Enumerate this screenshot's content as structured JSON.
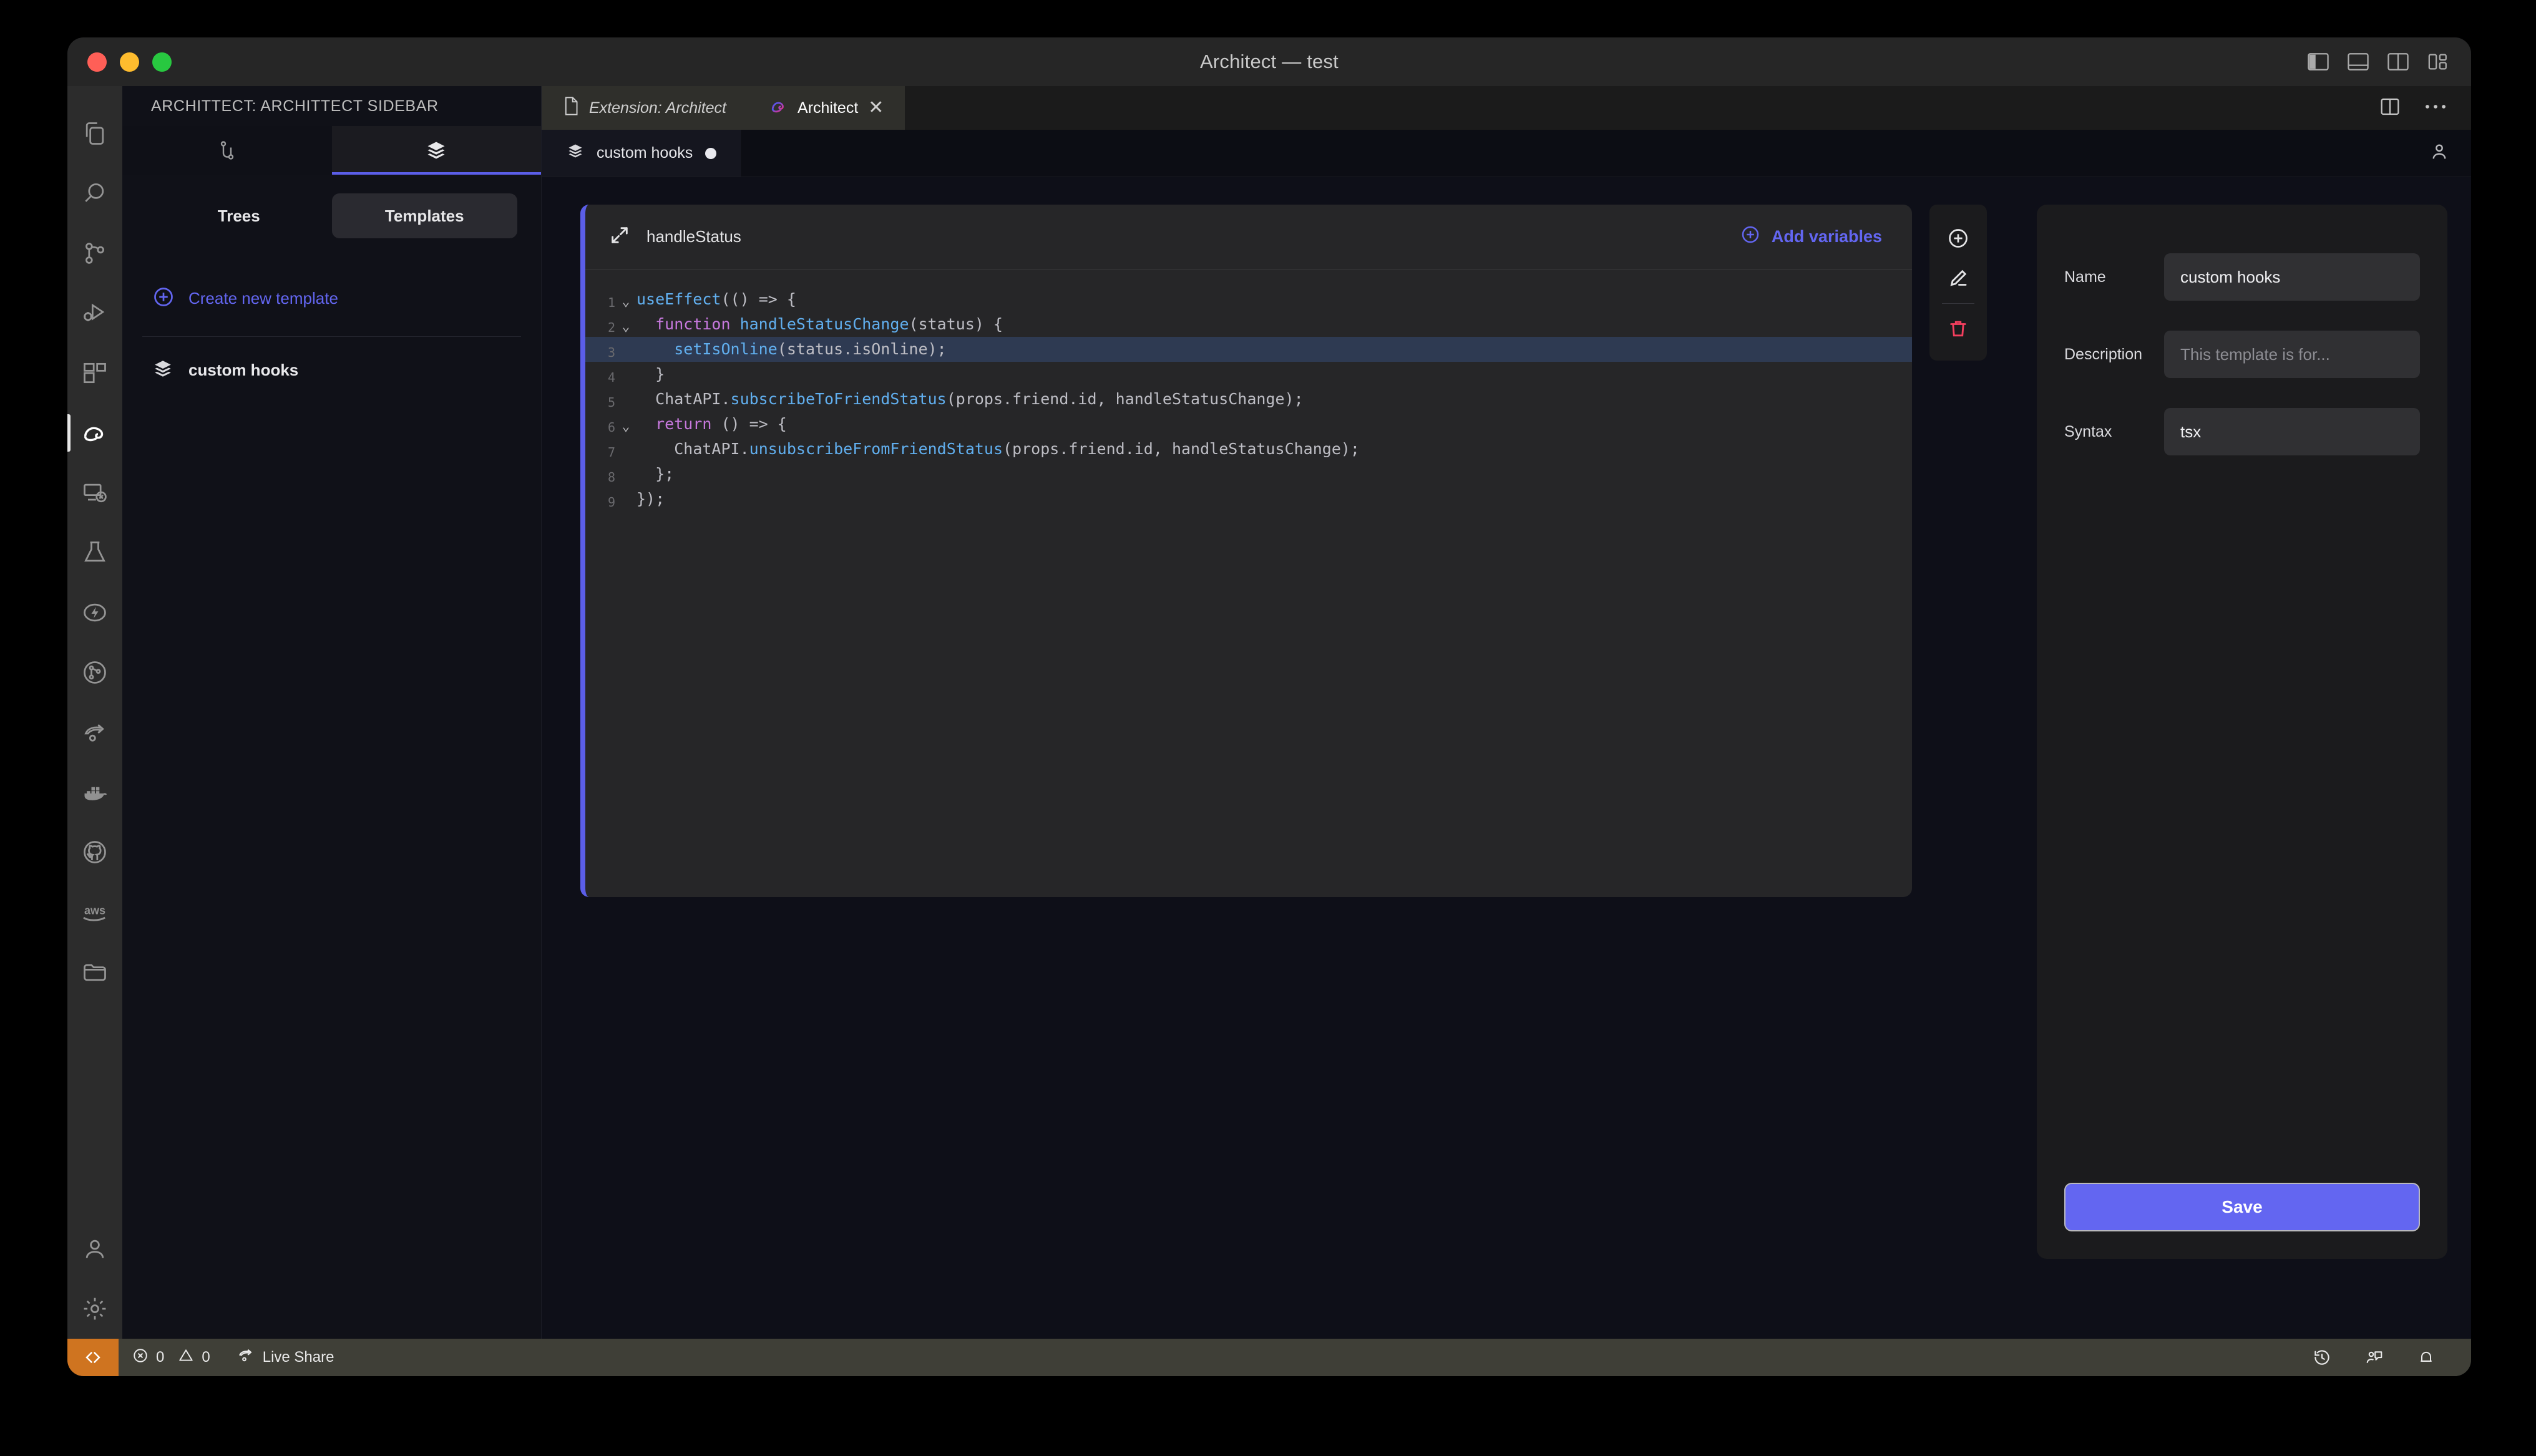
{
  "window": {
    "title": "Architect — test",
    "traffic_lights": [
      "close",
      "minimize",
      "maximize"
    ],
    "layout_icons": [
      "toggle-primary-sidebar-icon",
      "toggle-panel-icon",
      "toggle-secondary-sidebar-icon",
      "customize-layout-icon"
    ]
  },
  "activity_bar": {
    "items": [
      {
        "name": "explorer-icon",
        "active": false
      },
      {
        "name": "search-icon",
        "active": false
      },
      {
        "name": "source-control-icon",
        "active": false
      },
      {
        "name": "run-and-debug-icon",
        "active": false
      },
      {
        "name": "extensions-icon",
        "active": false
      },
      {
        "name": "architect-icon",
        "active": true
      },
      {
        "name": "remote-explorer-icon",
        "active": false
      },
      {
        "name": "testing-flask-icon",
        "active": false
      },
      {
        "name": "thunder-client-icon",
        "active": false
      },
      {
        "name": "gitlens-icon",
        "active": false
      },
      {
        "name": "share-icon",
        "active": false
      },
      {
        "name": "docker-icon",
        "active": false
      },
      {
        "name": "github-icon",
        "active": false
      },
      {
        "name": "aws-icon",
        "active": false
      },
      {
        "name": "folder-icon",
        "active": false
      }
    ],
    "bottom": [
      {
        "name": "account-icon"
      },
      {
        "name": "settings-gear-icon"
      }
    ]
  },
  "sidebar": {
    "title": "ARCHITTECT: ARCHITTECT SIDEBAR",
    "view_tabs": [
      {
        "name": "trees-view-icon",
        "active": false
      },
      {
        "name": "templates-view-icon",
        "active": true
      }
    ],
    "segmented": {
      "options": [
        "Trees",
        "Templates"
      ],
      "selected": "Templates"
    },
    "create_new_template": "Create new template",
    "templates": [
      {
        "label": "custom hooks"
      }
    ]
  },
  "editor": {
    "tabs": [
      {
        "label": "Extension: Architect",
        "icon": "file-icon",
        "active": false,
        "italic": true,
        "closable": false
      },
      {
        "label": "Architect",
        "icon": "architect-logo-icon",
        "active": true,
        "italic": false,
        "closable": true
      }
    ],
    "tabbar_actions": [
      "split-editor-icon",
      "more-actions-icon"
    ],
    "inner_tabs": [
      {
        "label": "custom hooks",
        "icon": "layers-icon",
        "dirty": true,
        "active": true
      }
    ],
    "inner_tabbar_actions": [
      "account-icon"
    ]
  },
  "code_card": {
    "expand_icon": "expand-diagonal-icon",
    "title": "handleStatus",
    "add_variables_label": "Add variables",
    "accent_color": "#5b5ee8",
    "highlighted_line": 3,
    "lines": [
      {
        "n": 1,
        "fold": true,
        "indent": 0,
        "tokens": [
          {
            "t": "useEffect",
            "c": "k-fn"
          },
          {
            "t": "((",
            "c": "k-plain"
          },
          {
            "t": ") ",
            "c": "k-plain"
          },
          {
            "t": "=>",
            "c": "k-plain"
          },
          {
            "t": " {",
            "c": "k-plain"
          }
        ]
      },
      {
        "n": 2,
        "fold": true,
        "indent": 1,
        "tokens": [
          {
            "t": "function ",
            "c": "k-kw"
          },
          {
            "t": "handleStatusChange",
            "c": "k-fn"
          },
          {
            "t": "(status) {",
            "c": "k-plain"
          }
        ]
      },
      {
        "n": 3,
        "fold": false,
        "indent": 2,
        "tokens": [
          {
            "t": "setIsOnline",
            "c": "k-fn"
          },
          {
            "t": "(status.isOnline);",
            "c": "k-plain"
          }
        ]
      },
      {
        "n": 4,
        "fold": false,
        "indent": 1,
        "tokens": [
          {
            "t": "}",
            "c": "k-plain"
          }
        ]
      },
      {
        "n": 5,
        "fold": false,
        "indent": 1,
        "tokens": [
          {
            "t": "ChatAPI.",
            "c": "k-plain"
          },
          {
            "t": "subscribeToFriendStatus",
            "c": "k-fn"
          },
          {
            "t": "(props.friend.id, handleStatusChange);",
            "c": "k-plain"
          }
        ]
      },
      {
        "n": 6,
        "fold": true,
        "indent": 1,
        "tokens": [
          {
            "t": "return ",
            "c": "k-kw"
          },
          {
            "t": "() ",
            "c": "k-plain"
          },
          {
            "t": "=>",
            "c": "k-plain"
          },
          {
            "t": " {",
            "c": "k-plain"
          }
        ]
      },
      {
        "n": 7,
        "fold": false,
        "indent": 2,
        "tokens": [
          {
            "t": "ChatAPI.",
            "c": "k-plain"
          },
          {
            "t": "unsubscribeFromFriendStatus",
            "c": "k-fn"
          },
          {
            "t": "(props.friend.id, handleStatusChange);",
            "c": "k-plain"
          }
        ]
      },
      {
        "n": 8,
        "fold": false,
        "indent": 1,
        "tokens": [
          {
            "t": "};",
            "c": "k-plain"
          }
        ]
      },
      {
        "n": 9,
        "fold": false,
        "indent": 0,
        "tokens": [
          {
            "t": "});",
            "c": "k-plain"
          }
        ]
      }
    ]
  },
  "right_toolbar": [
    {
      "name": "add-circle-icon",
      "color": "#e4e4e6"
    },
    {
      "name": "edit-pencil-icon",
      "color": "#e4e4e6"
    },
    {
      "name": "delete-trash-icon",
      "color": "#f43f5e"
    }
  ],
  "right_panel": {
    "fields": [
      {
        "label": "Name",
        "value": "custom hooks",
        "placeholder": "",
        "is_placeholder": false
      },
      {
        "label": "Description",
        "value": "",
        "placeholder": "This template is for...",
        "is_placeholder": true
      },
      {
        "label": "Syntax",
        "value": "tsx",
        "placeholder": "",
        "is_placeholder": false
      }
    ],
    "save_label": "Save",
    "save_color": "#6366f1"
  },
  "status_bar": {
    "remote_icon": "remote-window-icon",
    "remote_color": "#cf7420",
    "errors": "0",
    "warnings": "0",
    "live_share": "Live Share",
    "right_icons": [
      "history-icon",
      "feedback-icon",
      "bell-icon"
    ]
  }
}
